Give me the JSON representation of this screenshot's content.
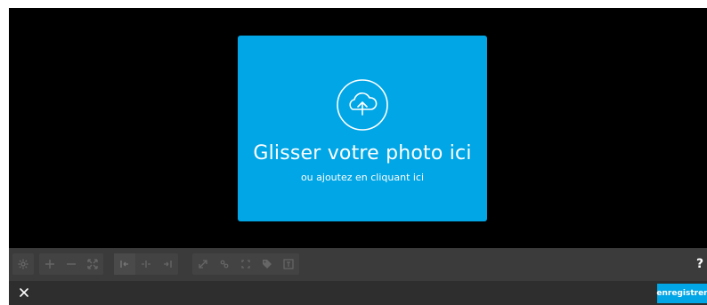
{
  "dropzone": {
    "title": "Glisser votre photo ici",
    "subtitle": "ou ajoutez en cliquant ici",
    "icon": "cloud-upload-icon"
  },
  "toolbar": {
    "tools": [
      "settings-icon",
      "zoom-in-icon",
      "zoom-out-icon",
      "fit-icon",
      "align-left-icon",
      "align-center-icon",
      "align-right-icon",
      "expand-icon",
      "link-icon",
      "crop-icon",
      "tag-icon",
      "text-icon"
    ],
    "help_label": "?"
  },
  "footer": {
    "close_icon": "close-icon",
    "save_label": "enregistrer"
  },
  "colors": {
    "accent": "#00a6e6",
    "stage": "#000000",
    "toolbar": "#3b3b3b",
    "footer": "#2e2e2e"
  }
}
